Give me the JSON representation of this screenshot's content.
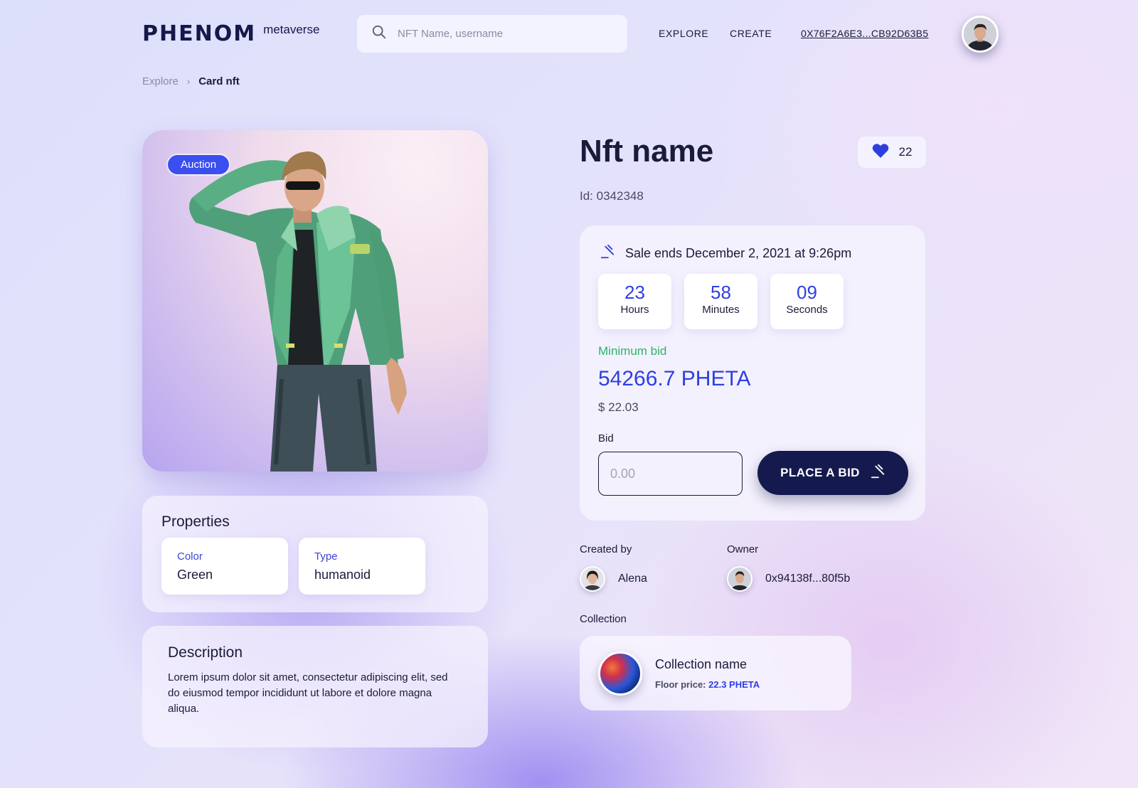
{
  "header": {
    "logo_main": "PHENOM",
    "logo_sub": "metaverse",
    "search_placeholder": "NFT Name, username",
    "nav": [
      "EXPLORE",
      "CREATE"
    ],
    "wallet": "0X76F2A6E3...CB92D63B5"
  },
  "breadcrumb": {
    "prev": "Explore",
    "separator": "›",
    "current": "Card nft"
  },
  "nft": {
    "badge": "Auction",
    "title": "Nft name",
    "likes": "22",
    "id": "Id: 0342348"
  },
  "properties": {
    "title": "Properties",
    "items": [
      {
        "label": "Color",
        "value": "Green"
      },
      {
        "label": "Type",
        "value": "humanoid"
      }
    ]
  },
  "description": {
    "title": "Description",
    "text": "Lorem ipsum dolor sit amet, consectetur adipiscing elit, sed do eiusmod tempor incididunt ut labore et dolore magna aliqua."
  },
  "sale": {
    "ends": "Sale ends December 2, 2021 at 9:26pm",
    "countdown": [
      {
        "value": "23",
        "label": "Hours"
      },
      {
        "value": "58",
        "label": "Minutes"
      },
      {
        "value": "09",
        "label": "Seconds"
      }
    ],
    "min_bid_label": "Minimum bid",
    "min_bid": "54266.7 PHETA",
    "usd": "$ 22.03",
    "bid_label": "Bid",
    "bid_placeholder": "0.00",
    "button": "PLACE A BID"
  },
  "creator": {
    "label": "Created by",
    "name": "Alena"
  },
  "owner": {
    "label": "Owner",
    "name": "0x94138f...80f5b"
  },
  "collection": {
    "label": "Collection",
    "name": "Collection name",
    "floor_label": "Floor price:",
    "floor_value": "22.3 PHETA"
  },
  "colors": {
    "accent": "#2e3fe0",
    "dark_button": "#151a4e",
    "green": "#2fb36a"
  },
  "icons": {
    "search": "search-icon",
    "heart": "heart-icon",
    "gavel": "gavel-icon"
  }
}
